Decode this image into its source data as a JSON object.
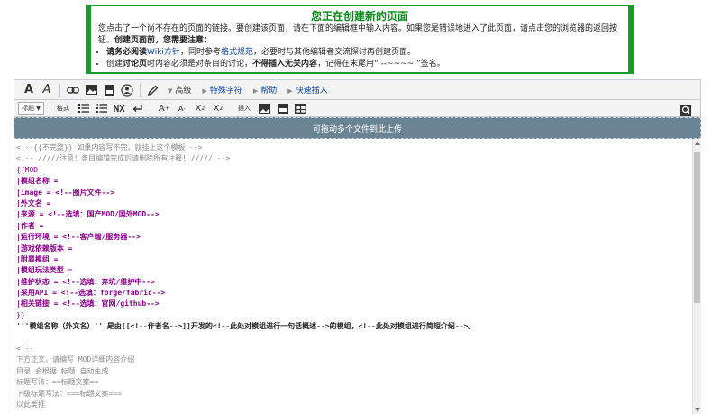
{
  "notice": {
    "title": "您正在创建新的页面",
    "p1": "您点击了一个尚不存在的页面的链接。要创建该页面，请在下面的编辑框中输入内容。如果您是错误地进入了此页面，请点击您的浏览器的返回按钮。",
    "p1_bold": "创建页面前，您需要注意：",
    "li1_bold": "请务必阅读",
    "li1_link1": "Wiki方针",
    "li1_text1": "，同时参考",
    "li1_link2": "格式规范",
    "li1_text2": "，必要时与其他编辑者交流探讨再创建页面。",
    "li2_text1": "创建",
    "li2_bold1": "讨论页",
    "li2_text2": "时内容必须是对条目的讨论，",
    "li2_bold2": "不得插入无关内容",
    "li2_text3": "，记得在末尾用“ --~~~~ ”签名。"
  },
  "toolbar": {
    "bold": "A",
    "italic": "A",
    "advanced": "高级",
    "special_chars": "特殊字符",
    "help": "帮助",
    "quick_insert": "快速插入",
    "heading_select": "标题",
    "format": "格式",
    "insert": "插入"
  },
  "dropzone": {
    "label": "可拖动多个文件到此上传"
  },
  "editor": {
    "lines": [
      "<!--{{不完整}} 如果内容写不完，就挂上这个模板 -->",
      "<!-- /////注意！条目编辑完成后请删除所有注释! ///// -->",
      "{{MOD",
      "|模组名称 =",
      "|image = <!--图片文件-->",
      "|外文名 =",
      "|来源 = <!--选填：国产MOD/国外MOD-->",
      "|作者 =",
      "|运行环境 = <!--客户端/服务器-->",
      "|游戏依赖版本 =",
      "|附属模组 =",
      "|模组玩法类型 =",
      "|维护状态 = <!--选填：弃坑/维护中-->",
      "|采用API = <!--选填：forge/fabric-->",
      "|相关链接 = <!--选填：官网/github-->",
      "}}",
      "'''模组名称（外文名）'''是由[[<!--作者名-->]]开发的<!--此处对模组进行一句话概述-->的模组，<!--此处对模组进行简短介绍-->。",
      "",
      "<!--",
      "下方正文，请编写 MOD详细内容介绍",
      "目录 会根据 标题 自动生成",
      "标题写法：==标题文案==",
      "下级标题写法：===标题文案===",
      "以此类推"
    ]
  },
  "colors": {
    "notice_border": "#1a9a2a",
    "dropzone_bg": "#6b8493",
    "link": "#0645ad",
    "param": "#8b008b",
    "comment": "#888888"
  }
}
